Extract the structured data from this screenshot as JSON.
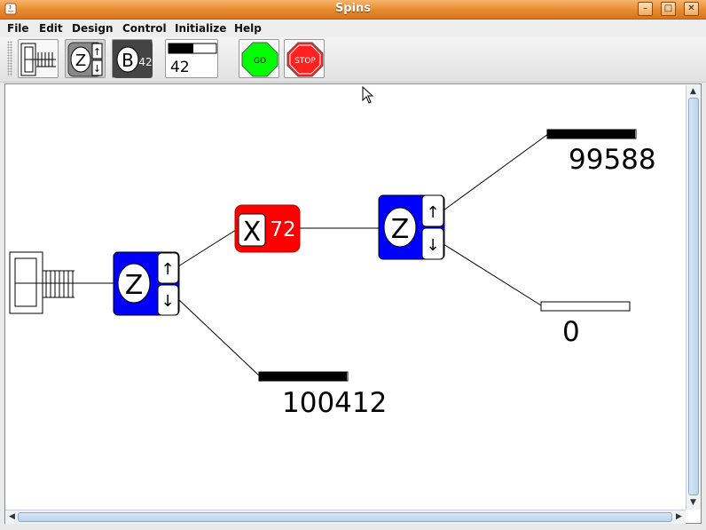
{
  "window": {
    "title": "Spins",
    "controls": {
      "minimize": "–",
      "maximize": "□",
      "close": "✕"
    }
  },
  "menu": {
    "items": [
      {
        "label": "File",
        "mnemonic": "F"
      },
      {
        "label": "Edit",
        "mnemonic": "E"
      },
      {
        "label": "Design",
        "mnemonic": "D"
      },
      {
        "label": "Control",
        "mnemonic": "C"
      },
      {
        "label": "Initialize",
        "mnemonic": "I"
      },
      {
        "label": "Help",
        "mnemonic": "H"
      }
    ]
  },
  "toolbar": {
    "buttons": [
      {
        "name": "source-oven-tool",
        "icon": "oven-source-icon"
      },
      {
        "name": "stern-gerlach-z-tool",
        "icon": "stern-gerlach-z-icon",
        "glyph": "Z"
      },
      {
        "name": "magnet-b-tool",
        "icon": "magnet-b-icon",
        "glyph": "B",
        "value": "42"
      },
      {
        "name": "counter-tool",
        "icon": "counter-icon",
        "value": "42"
      },
      {
        "name": "go-button",
        "label": "GO",
        "color": "#00ff00"
      },
      {
        "name": "stop-button",
        "label": "STOP",
        "color": "#ff2020"
      }
    ]
  },
  "diagram": {
    "analyzers": [
      {
        "id": "analyzer-1",
        "glyph": "Z",
        "up": "↑",
        "down": "↓",
        "color": "#0000ff"
      },
      {
        "id": "analyzer-2",
        "glyph": "Z",
        "up": "↑",
        "down": "↓",
        "color": "#0000ff"
      }
    ],
    "magnet": {
      "glyph": "X",
      "value": "72",
      "color": "#ff0000"
    },
    "counters": [
      {
        "id": "counter-top",
        "count": "99588",
        "fill": 0.99
      },
      {
        "id": "counter-middle",
        "count": "0",
        "fill": 0.0
      },
      {
        "id": "counter-bottom",
        "count": "100412",
        "fill": 0.99
      }
    ]
  }
}
